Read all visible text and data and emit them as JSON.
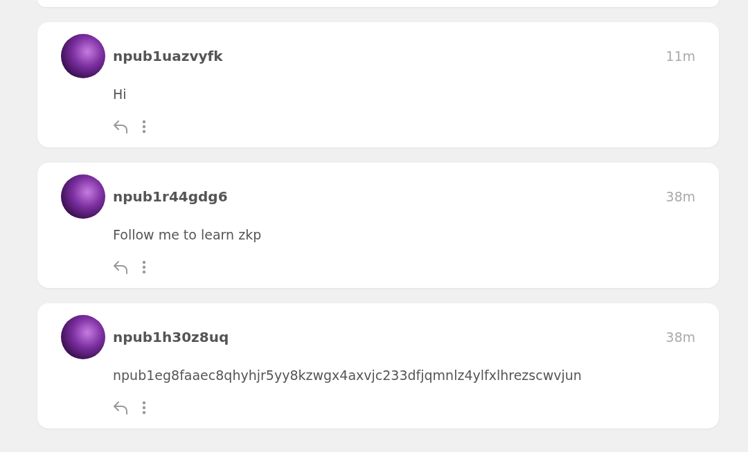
{
  "posts": [
    {
      "author": "npub1uazvyfk",
      "time": "11m",
      "content": "Hi"
    },
    {
      "author": "npub1r44gdg6",
      "time": "38m",
      "content": "Follow me to learn zkp"
    },
    {
      "author": "npub1h30z8uq",
      "time": "38m",
      "content": "npub1eg8faaec8qhyhjr5yy8kzwgx4axvjc233dfjqmnlz4ylfxlhrezscwvjun"
    }
  ]
}
